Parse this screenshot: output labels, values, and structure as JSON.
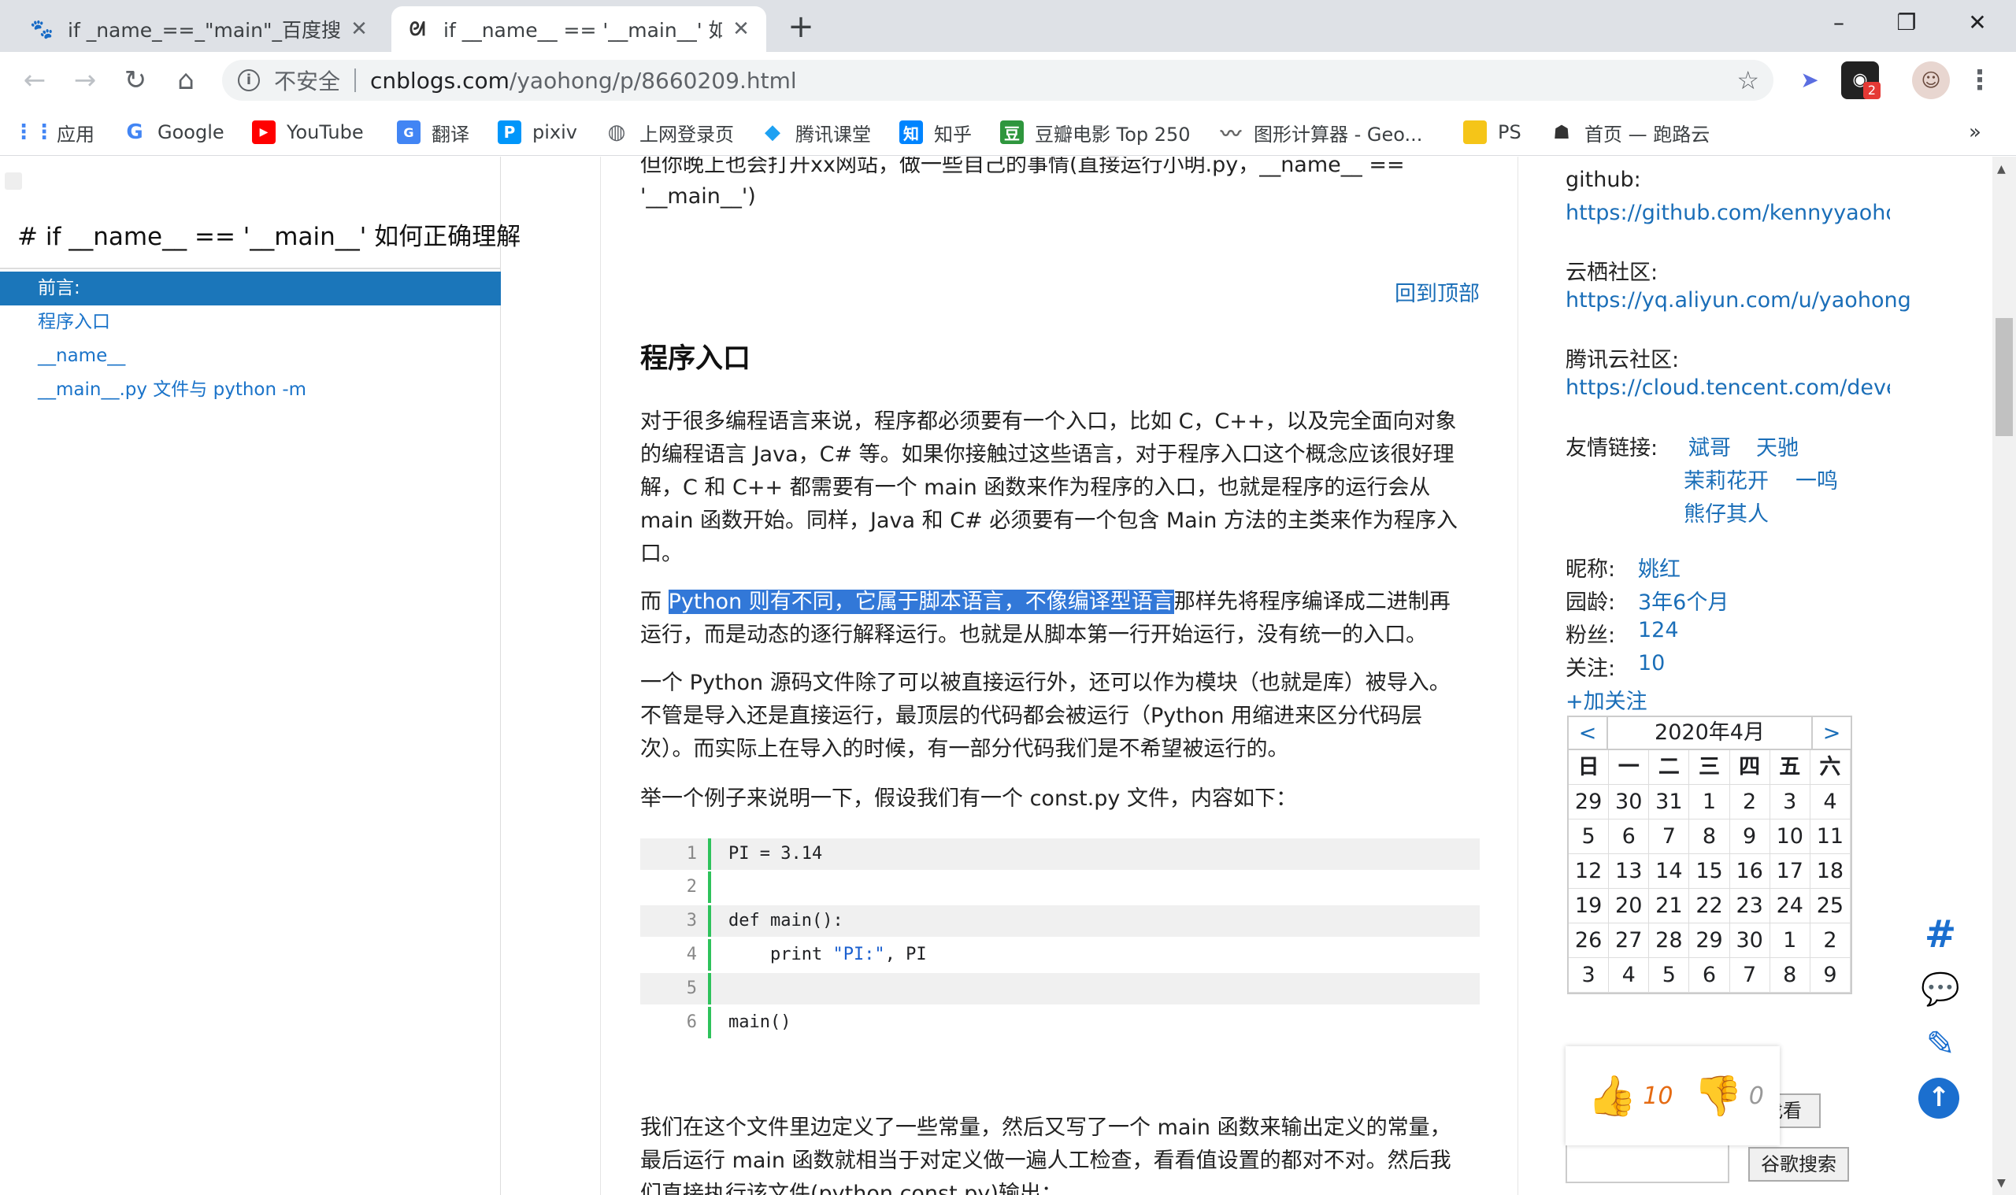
{
  "browser": {
    "tabs": [
      {
        "title": "if _name_==_\"main\"_百度搜索",
        "favicon": "paw-icon"
      },
      {
        "title": "if __name__ == '__main__' 如何",
        "favicon": "cnblogs-icon"
      }
    ],
    "new_tab": "+",
    "window_controls": [
      "–",
      "❐",
      "✕"
    ],
    "nav": {
      "back": "←",
      "forward": "→",
      "reload": "↻",
      "home": "⌂"
    },
    "security_label": "不安全",
    "url_host": "cnblogs.com",
    "url_path": "/yaohong/p/8660209.html",
    "extensions_badge": "2",
    "bookmarks": [
      "应用",
      "Google",
      "YouTube",
      "翻译",
      "pixiv",
      "上网登录页",
      "腾讯课堂",
      "知乎",
      "豆瓣电影 Top 250",
      "图形计算器 - Geo...",
      "PS",
      "首页 — 跑路云"
    ],
    "bookmarks_more": "»"
  },
  "toc": {
    "title": "# if __name__ == '__main__' 如何正确理解",
    "items": [
      "前言:",
      "程序入口",
      "__name__",
      "__main__.py 文件与 python -m"
    ]
  },
  "article": {
    "cut_line1": "但你晚上也会打开xx网站，做一些自己的事情(直接运行小明.py，__name__ ==",
    "cut_line2": "'__main__')",
    "back_to_top": "回到顶部",
    "heading": "程序入口",
    "p1": [
      "对于很多编程语言来说，程序都必须要有一个入口，比如 C，C++，以及完全面向对象",
      "的编程语言 Java，C# 等。如果你接触过这些语言，对于程序入口这个概念应该很好理",
      "解，C 和 C++ 都需要有一个 main 函数来作为程序的入口，也就是程序的运行会从",
      "main 函数开始。同样，Java 和 C# 必须要有一个包含 Main 方法的主类来作为程序入",
      "口。"
    ],
    "p2_prefix": "而 ",
    "p2_highlight": "Python 则有不同，它属于脚本语言，不像编译型语言",
    "p2_suffix": "那样先将程序编译成二进制再",
    "p2_line2": "运行，而是动态的逐行解释运行。也就是从脚本第一行开始运行，没有统一的入口。",
    "p3": [
      "一个 Python 源码文件除了可以被直接运行外，还可以作为模块（也就是库）被导入。",
      "不管是导入还是直接运行，最顶层的代码都会被运行（Python 用缩进来区分代码层",
      "次）。而实际上在导入的时候，有一部分代码我们是不希望被运行的。"
    ],
    "p4": "举一个例子来说明一下，假设我们有一个 const.py 文件，内容如下：",
    "code": [
      {
        "n": "1",
        "t": "PI = 3.14"
      },
      {
        "n": "2",
        "t": ""
      },
      {
        "n": "3",
        "t": "def main():"
      },
      {
        "n": "4",
        "t": "    print ",
        "s": "\"PI:\"",
        "r": ", PI"
      },
      {
        "n": "5",
        "t": ""
      },
      {
        "n": "6",
        "t": "main()"
      }
    ],
    "p5": [
      "我们在这个文件里边定义了一些常量，然后又写了一个 main 函数来输出定义的常量，",
      "最后运行 main 函数就相当于对定义做一遍人工检查，看看值设置的都对不对。然后我",
      "们直接执行该文件(python const.py)输出："
    ]
  },
  "sidebar": {
    "github_label": "github:",
    "github_url": "https://github.com/kennyyaohong",
    "yunqi_label": "云栖社区:",
    "yunqi_url": "https://yq.aliyun.com/u/yaohong",
    "tencent_label": "腾讯云社区:",
    "tencent_url": "https://cloud.tencent.com/develop",
    "friends_label": "友情链接:",
    "friends": [
      "斌哥",
      "天驰",
      "茉莉花开",
      "一鸣",
      "熊仔其人"
    ],
    "nickname_label": "昵称:",
    "nickname": "姚红",
    "age_label": "园龄:",
    "age": "3年6个月",
    "fans_label": "粉丝:",
    "fans": "124",
    "follow_label": "关注:",
    "follow": "10",
    "add_follow": "+加关注",
    "calendar": {
      "prev": "<",
      "next": ">",
      "month": "2020年4月",
      "weekdays": [
        "日",
        "一",
        "二",
        "三",
        "四",
        "五",
        "六"
      ],
      "weeks": [
        [
          "29",
          "30",
          "31",
          "1",
          "2",
          "3",
          "4"
        ],
        [
          "5",
          "6",
          "7",
          "8",
          "9",
          "10",
          "11"
        ],
        [
          "12",
          "13",
          "14",
          "15",
          "16",
          "17",
          "18"
        ],
        [
          "19",
          "20",
          "21",
          "22",
          "23",
          "24",
          "25"
        ],
        [
          "26",
          "27",
          "28",
          "29",
          "30",
          "1",
          "2"
        ],
        [
          "3",
          "4",
          "5",
          "6",
          "7",
          "8",
          "9"
        ]
      ]
    },
    "find_btn": "找看",
    "google_btn": "谷歌搜索"
  },
  "vote": {
    "up": "10",
    "down": "0"
  },
  "colors": {
    "accent": "#1b76ba",
    "link": "#1a6eb8",
    "code_gutter": "#2ec25b",
    "highlight": "#3278d8",
    "vote": "#e56b13"
  }
}
